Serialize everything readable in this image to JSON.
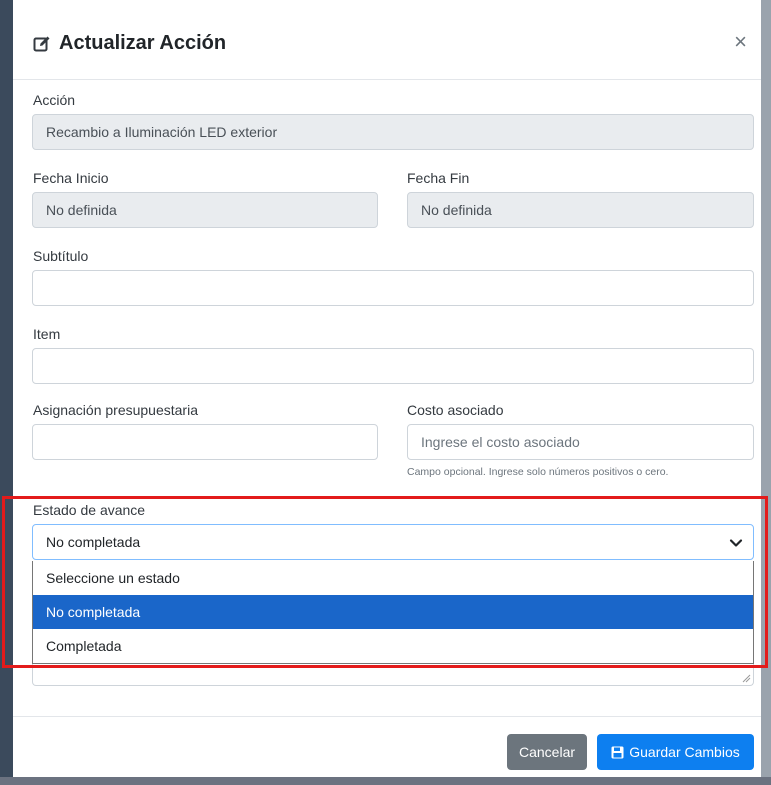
{
  "modal": {
    "title": "Actualizar Acción",
    "close_label": "×"
  },
  "form": {
    "accion": {
      "label": "Acción",
      "value": "Recambio a Iluminación LED exterior"
    },
    "fecha_inicio": {
      "label": "Fecha Inicio",
      "value": "No definida"
    },
    "fecha_fin": {
      "label": "Fecha Fin",
      "value": "No definida"
    },
    "subtitulo": {
      "label": "Subtítulo",
      "value": ""
    },
    "item": {
      "label": "Item",
      "value": ""
    },
    "asignacion": {
      "label": "Asignación presupuestaria",
      "value": ""
    },
    "costo": {
      "label": "Costo asociado",
      "placeholder": "Ingrese el costo asociado",
      "help": "Campo opcional. Ingrese solo números positivos o cero."
    },
    "estado": {
      "label": "Estado de avance",
      "selected": "No completada",
      "options": [
        "Seleccione un estado",
        "No completada",
        "Completada"
      ]
    }
  },
  "footer": {
    "cancel_label": "Cancelar",
    "save_label": "Guardar Cambios"
  },
  "colors": {
    "highlight": "#e31b1b",
    "primary": "#0d7ff0",
    "secondary": "#6c757d",
    "option_selected": "#1a66c9"
  },
  "icons": {
    "title": "edit-icon",
    "close": "close-icon",
    "select": "chevron-down-icon",
    "save": "save-icon"
  }
}
